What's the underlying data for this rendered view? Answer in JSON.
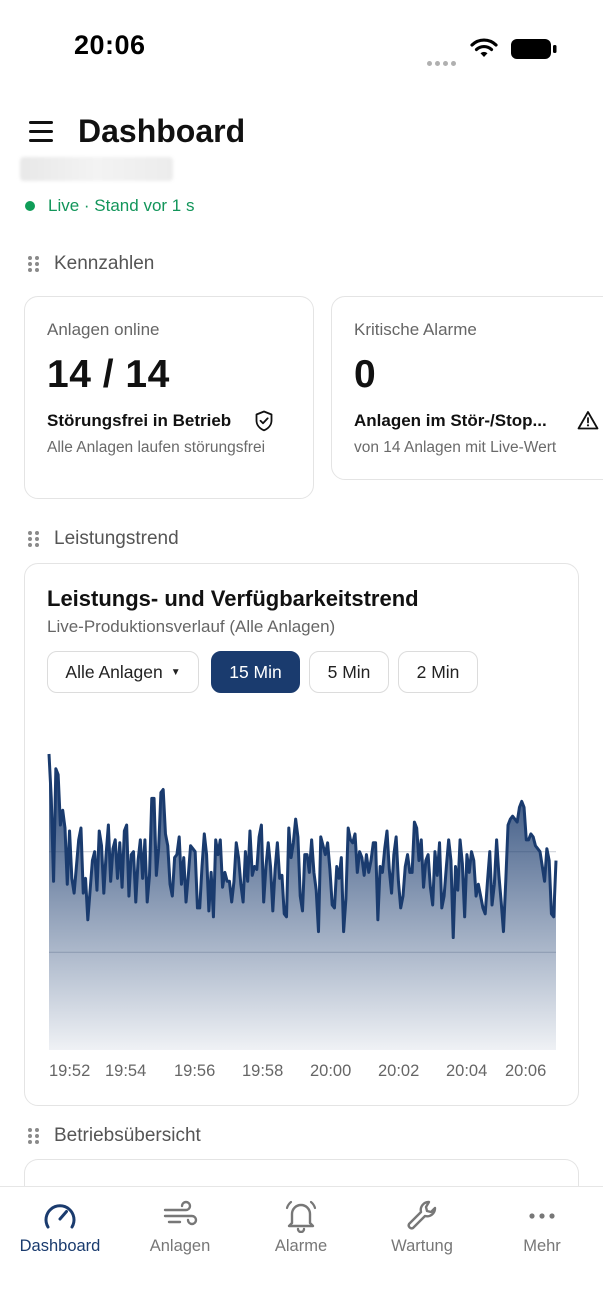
{
  "status_bar": {
    "time": "20:06"
  },
  "header": {
    "title": "Dashboard"
  },
  "live": {
    "text": "Live · Stand vor 1 s"
  },
  "sections": {
    "kpis": "Kennzahlen",
    "trend": "Leistungstrend",
    "overview": "Betriebsübersicht"
  },
  "kpi_cards": [
    {
      "label": "Anlagen online",
      "value": "14 / 14",
      "status": "Störungsfrei in Betrieb",
      "status_icon": "shield-check-icon",
      "description": "Alle Anlagen laufen störungsfrei"
    },
    {
      "label": "Kritische Alarme",
      "value": "0",
      "status": "Anlagen im Stör-/Stop...",
      "status_icon": "warning-triangle-icon",
      "description": "von 14 Anlagen mit Live-Wert"
    }
  ],
  "trend_card": {
    "title": "Leistungs- und Verfügbarkeitstrend",
    "subtitle": "Live-Produktionsverlauf (Alle Anlagen)",
    "filter": {
      "selected": "Alle Anlagen"
    },
    "ranges": [
      {
        "label": "15 Min",
        "active": true
      },
      {
        "label": "5 Min",
        "active": false
      },
      {
        "label": "2 Min",
        "active": false
      }
    ]
  },
  "chart_data": {
    "type": "area",
    "title": "Leistungs- und Verfügbarkeitstrend",
    "subtitle": "Live-Produktionsverlauf (Alle Anlagen)",
    "x_tick_labels": [
      "19:52",
      "19:54",
      "19:56",
      "19:58",
      "20:00",
      "20:02",
      "20:04",
      "20:06"
    ],
    "x_range": [
      "19:52",
      "20:06"
    ],
    "ylim": [
      0,
      100
    ],
    "grid": true,
    "y_gridlines": [
      33,
      67
    ],
    "color": "#1a3b6e",
    "values": [
      100,
      85,
      57,
      95,
      93,
      76,
      81,
      75,
      56,
      74,
      58,
      53,
      62,
      71,
      75,
      53,
      58,
      44,
      54,
      64,
      67,
      54,
      74,
      69,
      53,
      66,
      76,
      57,
      68,
      71,
      58,
      70,
      55,
      74,
      76,
      52,
      66,
      67,
      50,
      64,
      71,
      58,
      71,
      50,
      59,
      85,
      85,
      59,
      68,
      87,
      88,
      73,
      69,
      56,
      52,
      65,
      66,
      72,
      56,
      65,
      50,
      59,
      69,
      68,
      67,
      48,
      48,
      62,
      73,
      66,
      47,
      60,
      45,
      71,
      66,
      71,
      55,
      60,
      57,
      57,
      50,
      57,
      70,
      65,
      56,
      50,
      67,
      57,
      74,
      59,
      62,
      61,
      72,
      76,
      50,
      62,
      70,
      62,
      47,
      61,
      70,
      58,
      59,
      46,
      45,
      75,
      65,
      70,
      78,
      72,
      52,
      47,
      66,
      66,
      60,
      71,
      60,
      54,
      40,
      72,
      69,
      66,
      70,
      61,
      49,
      48,
      62,
      58,
      65,
      40,
      51,
      75,
      71,
      70,
      73,
      60,
      67,
      65,
      59,
      66,
      60,
      64,
      70,
      70,
      44,
      62,
      60,
      68,
      74,
      61,
      53,
      66,
      72,
      57,
      48,
      52,
      62,
      66,
      60,
      60,
      77,
      75,
      64,
      71,
      55,
      64,
      66,
      55,
      49,
      67,
      59,
      70,
      48,
      52,
      62,
      71,
      64,
      38,
      62,
      54,
      71,
      63,
      45,
      66,
      60,
      67,
      64,
      52,
      56,
      52,
      48,
      46,
      57,
      67,
      49,
      56,
      71,
      59,
      50,
      40,
      57,
      76,
      78,
      79,
      78,
      77,
      82,
      84,
      82,
      71,
      71,
      73,
      72,
      69,
      68,
      67,
      62,
      57,
      68,
      64,
      46,
      45,
      64
    ]
  },
  "bottom_nav": [
    {
      "label": "Dashboard",
      "icon": "gauge-icon",
      "active": true
    },
    {
      "label": "Anlagen",
      "icon": "wind-icon",
      "active": false
    },
    {
      "label": "Alarme",
      "icon": "bell-icon",
      "active": false
    },
    {
      "label": "Wartung",
      "icon": "wrench-icon",
      "active": false
    },
    {
      "label": "Mehr",
      "icon": "more-dots-icon",
      "active": false
    }
  ],
  "colors": {
    "accent": "#1a3b6e",
    "live": "#12955a"
  }
}
